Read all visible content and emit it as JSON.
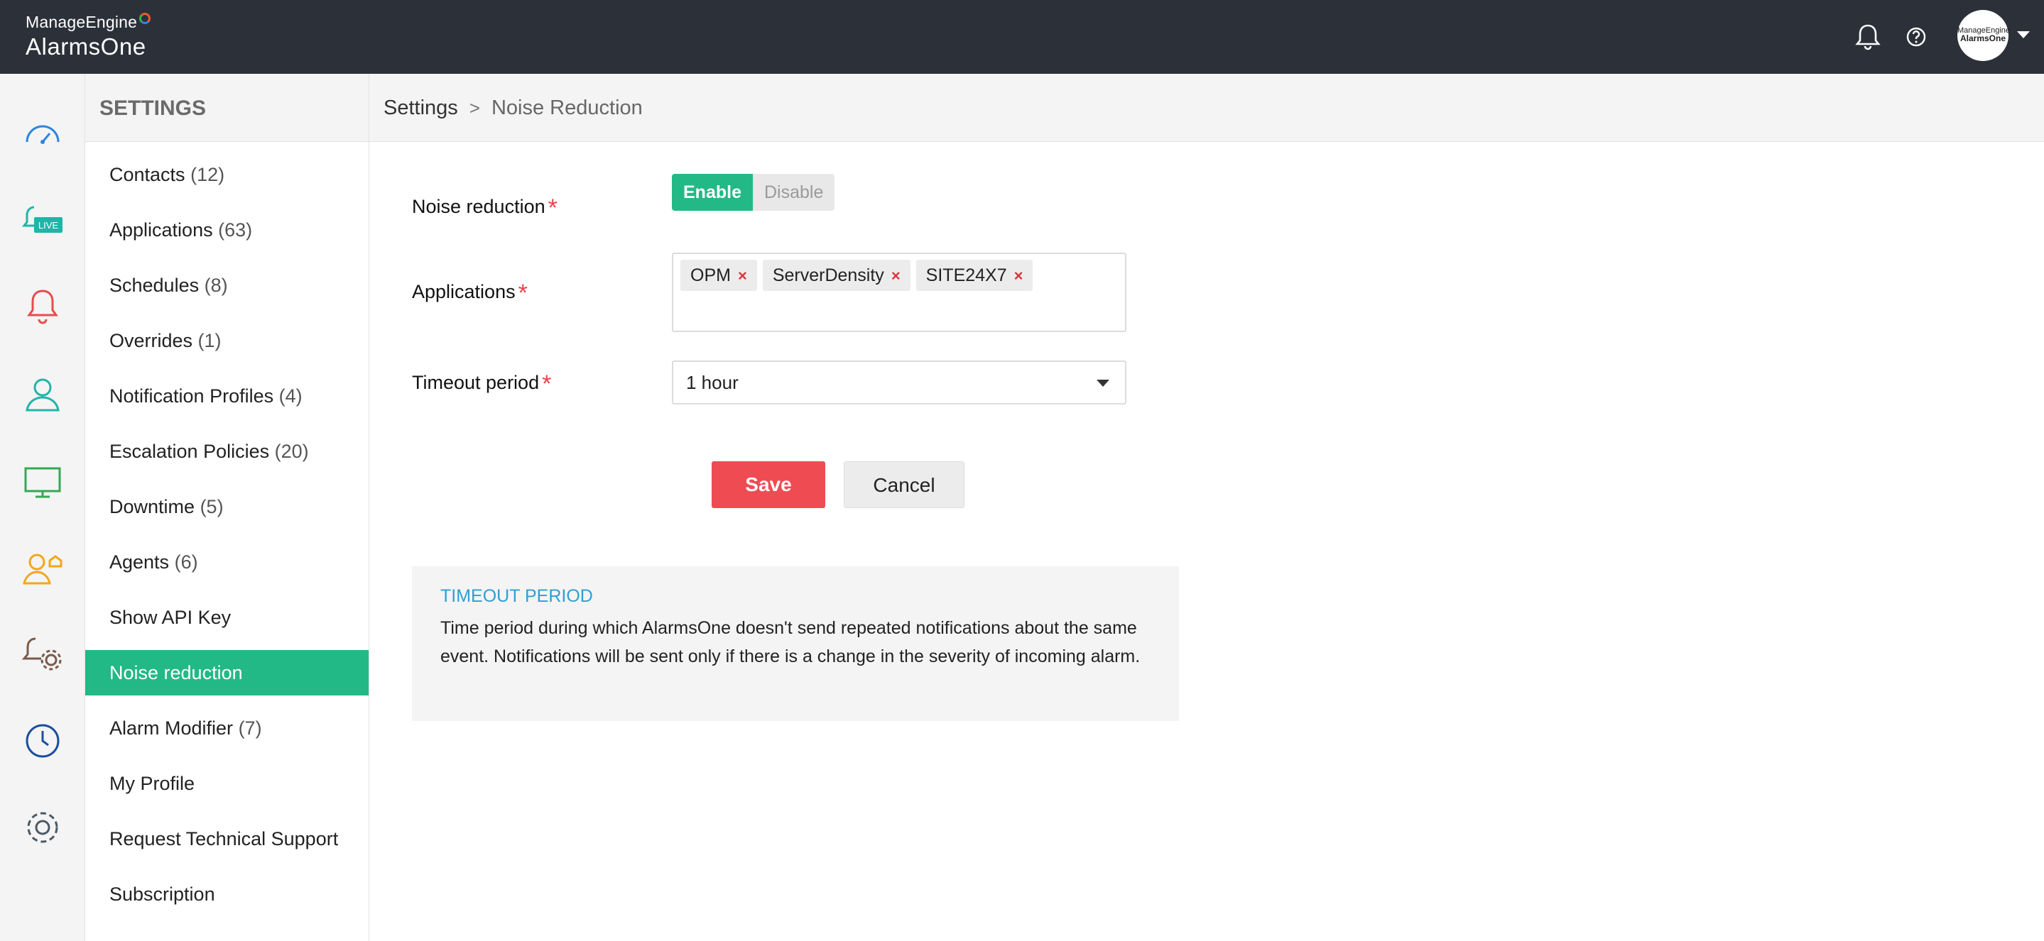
{
  "brand": {
    "top": "ManageEngine",
    "name": "AlarmsOne"
  },
  "header": {
    "avatar_top": "ManageEngine",
    "avatar_name": "AlarmsOne"
  },
  "rail": {
    "items": [
      "dashboard-icon",
      "live-alarms-icon",
      "alarms-icon",
      "users-icon",
      "monitor-icon",
      "contact-group-icon",
      "settings-automation-icon",
      "history-icon",
      "settings-icon"
    ],
    "live_badge": "LIVE",
    "colors": {
      "blue": "#2e86de",
      "teal": "#1fb5a8",
      "red": "#e84b4b",
      "green": "#35a853",
      "orange": "#f2a71b",
      "brown": "#7a5a4a",
      "navy": "#1b4fa0",
      "gray": "#4a5a66"
    }
  },
  "sidebar": {
    "heading": "SETTINGS",
    "items": [
      {
        "label": "Contacts",
        "count": "(12)"
      },
      {
        "label": "Applications",
        "count": "(63)"
      },
      {
        "label": "Schedules",
        "count": "(8)"
      },
      {
        "label": "Overrides",
        "count": "(1)"
      },
      {
        "label": "Notification Profiles",
        "count": "(4)"
      },
      {
        "label": "Escalation Policies",
        "count": "(20)"
      },
      {
        "label": "Downtime",
        "count": "(5)"
      },
      {
        "label": "Agents",
        "count": "(6)"
      },
      {
        "label": "Show API Key",
        "count": ""
      },
      {
        "label": "Noise reduction",
        "count": ""
      },
      {
        "label": "Alarm Modifier",
        "count": "(7)"
      },
      {
        "label": "My Profile",
        "count": ""
      },
      {
        "label": "Request Technical Support",
        "count": ""
      },
      {
        "label": "Subscription",
        "count": ""
      }
    ],
    "active_index": 9,
    "active_color": "#22b987"
  },
  "breadcrumb": {
    "root": "Settings",
    "separator": ">",
    "current": "Noise Reduction"
  },
  "form": {
    "noise_label": "Noise reduction",
    "required_mark": "*",
    "enable_label": "Enable",
    "disable_label": "Disable",
    "applications_label": "Applications",
    "applications": [
      "OPM",
      "ServerDensity",
      "SITE24X7"
    ],
    "remove_mark": "×",
    "timeout_label": "Timeout period",
    "timeout_value": "1 hour",
    "save_label": "Save",
    "cancel_label": "Cancel"
  },
  "info": {
    "title": "TIMEOUT PERIOD",
    "body": "Time period during which AlarmsOne doesn't send repeated notifications about the same event. Notifications will be sent only if there is a change in the severity of incoming alarm."
  }
}
